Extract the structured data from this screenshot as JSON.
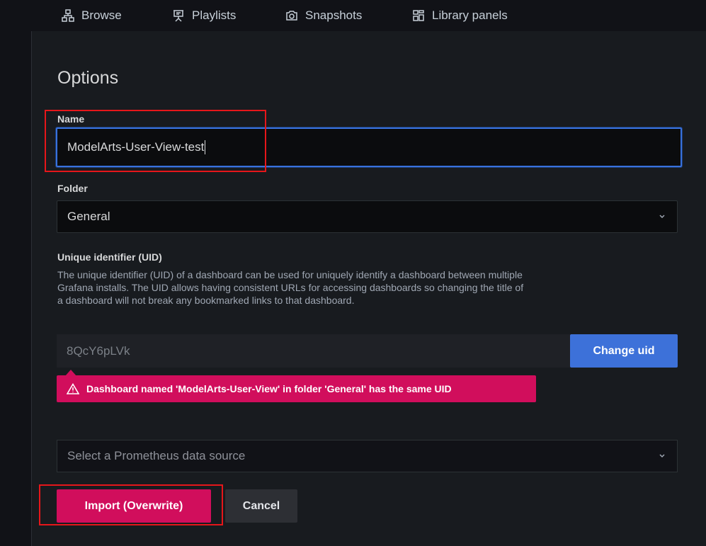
{
  "nav": {
    "tabs": [
      {
        "label": "Browse",
        "icon": "sitemap-icon"
      },
      {
        "label": "Playlists",
        "icon": "presentation-icon"
      },
      {
        "label": "Snapshots",
        "icon": "camera-icon"
      },
      {
        "label": "Library panels",
        "icon": "library-panels-icon"
      }
    ]
  },
  "options": {
    "title": "Options",
    "name_label": "Name",
    "name_value": "ModelArts-User-View-test",
    "folder_label": "Folder",
    "folder_value": "General",
    "uid_label": "Unique identifier (UID)",
    "uid_description": "The unique identifier (UID) of a dashboard can be used for uniquely identify a dashboard between multiple Grafana installs. The UID allows having consistent URLs for accessing dashboards so changing the title of a dashboard will not break any bookmarked links to that dashboard.",
    "uid_value": "8QcY6pLVk",
    "change_uid_label": "Change uid",
    "alert_text": "Dashboard named 'ModelArts-User-View' in folder 'General' has the same UID",
    "datasource_placeholder": "Select a Prometheus data source",
    "import_label": "Import (Overwrite)",
    "cancel_label": "Cancel"
  },
  "colors": {
    "accent_blue": "#3d71d9",
    "danger": "#d10e5c",
    "highlight_box": "#e6161a"
  }
}
